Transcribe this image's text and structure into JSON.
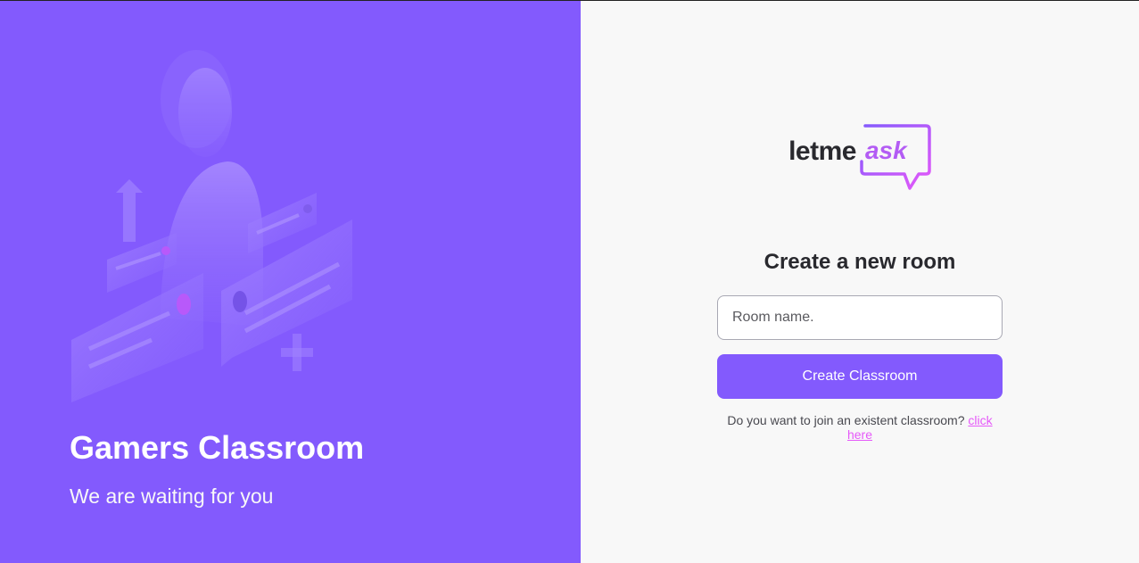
{
  "aside": {
    "title": "Gamers Classroom",
    "subtitle": "We are waiting for you",
    "illustration_icon": "person-with-chat-bubbles-illustration"
  },
  "logo": {
    "part1": "letme",
    "part2": "ask"
  },
  "form": {
    "heading": "Create a new room",
    "input_placeholder": "Room name.",
    "input_value": "",
    "button_label": "Create Classroom"
  },
  "join": {
    "prompt": "Do you want to join an existent classroom?",
    "link_label": "click here"
  },
  "colors": {
    "purple": "#835afd",
    "pink": "#e559f9",
    "background": "#f8f8f8",
    "text_dark": "#29292e"
  }
}
